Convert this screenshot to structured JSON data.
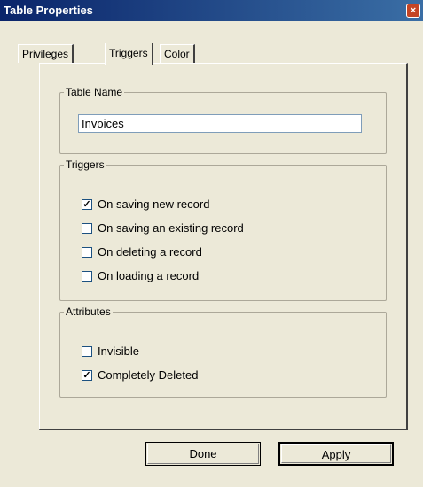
{
  "window": {
    "title": "Table Properties",
    "close_icon": "×"
  },
  "tabs": [
    {
      "label": "Privileges",
      "active": false
    },
    {
      "label": "Triggers",
      "active": true
    },
    {
      "label": "Color",
      "active": false
    }
  ],
  "table_name": {
    "legend": "Table Name",
    "value": "Invoices"
  },
  "triggers": {
    "legend": "Triggers",
    "items": [
      {
        "label": "On saving new record",
        "checked": true,
        "mark": "✓"
      },
      {
        "label": "On saving an existing record",
        "checked": false,
        "mark": ""
      },
      {
        "label": "On deleting a record",
        "checked": false,
        "mark": ""
      },
      {
        "label": "On loading a record",
        "checked": false,
        "mark": ""
      }
    ]
  },
  "attributes": {
    "legend": "Attributes",
    "items": [
      {
        "label": "Invisible",
        "checked": false,
        "mark": ""
      },
      {
        "label": "Completely Deleted",
        "checked": true,
        "mark": "✓"
      }
    ]
  },
  "buttons": {
    "done": "Done",
    "apply": "Apply"
  },
  "colors": {
    "titlebar_start": "#0a246a",
    "titlebar_end": "#3a6ea5",
    "dialog_bg": "#ece9d8",
    "close_button": "#c44525"
  }
}
